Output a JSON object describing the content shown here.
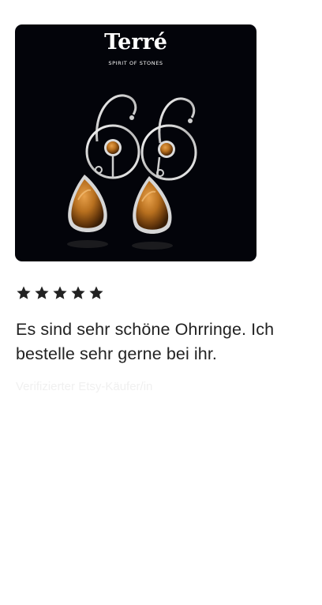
{
  "product": {
    "image_alt": "Tigerauge Ohrringe Silber",
    "logo_text": "Terré",
    "logo_tagline": "SPIRIT OF STONES"
  },
  "review": {
    "rating": 5,
    "rating_max": 5,
    "text": "Es sind sehr schöne Ohrringe. Ich bestelle sehr gerne bei ihr.",
    "reviewer_label": "Verifizierter Etsy-Käufer/in"
  },
  "colors": {
    "star": "#222222",
    "text": "#222222",
    "image_background": "#03040a",
    "stone": "#a8661c",
    "silver": "#d8d8d8"
  }
}
